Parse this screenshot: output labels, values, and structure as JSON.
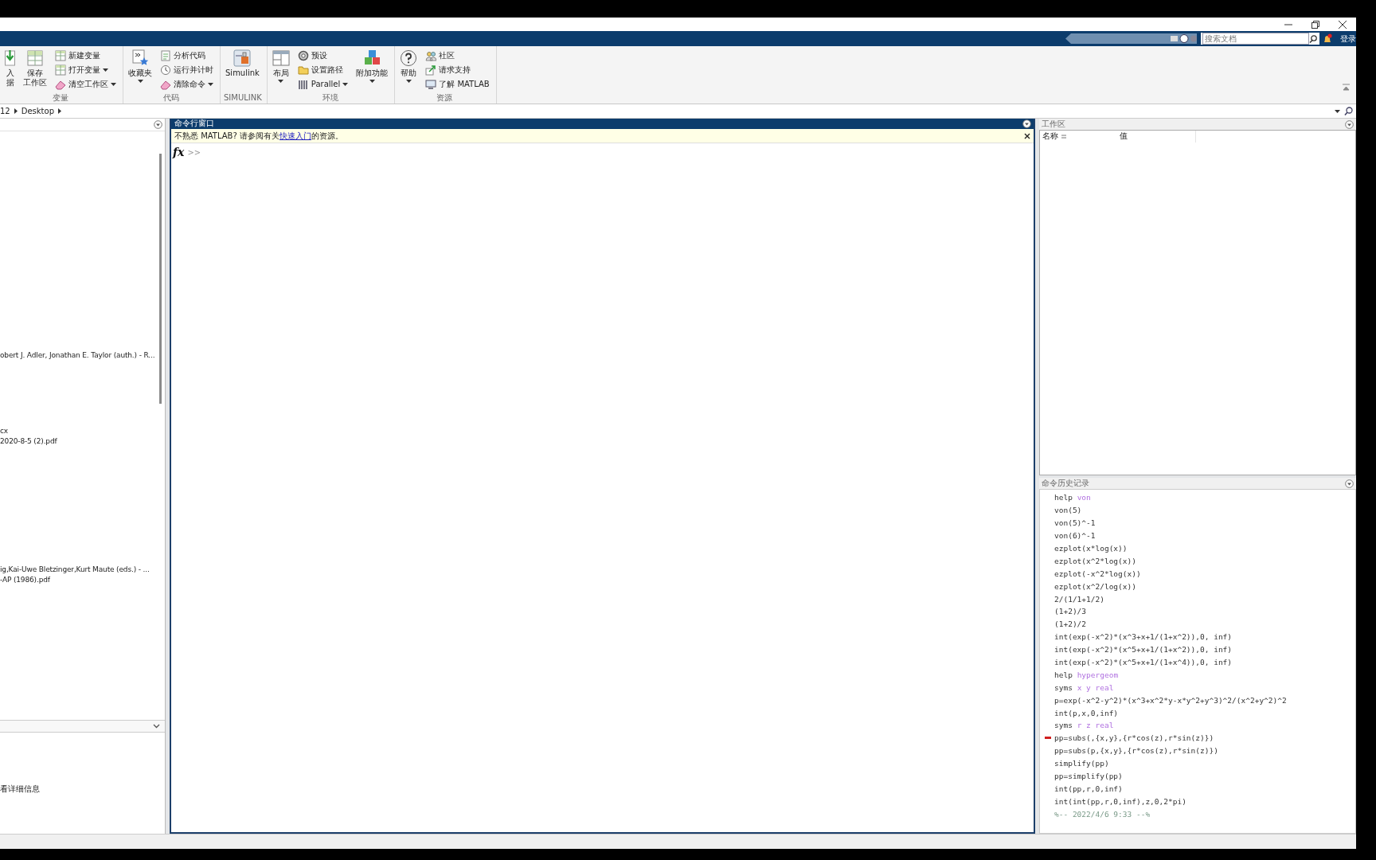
{
  "top_bar": {
    "search": {
      "placeholder": "搜索文档"
    },
    "sign_in": "登录"
  },
  "toolstrip": {
    "groups": [
      {
        "label": "变量",
        "items": [
          {
            "kind": "large",
            "lines": [
              "入",
              "据"
            ],
            "dropdown": false
          },
          {
            "kind": "large",
            "lines": [
              "保存",
              "工作区"
            ],
            "dropdown": false
          },
          {
            "kind": "stack",
            "buttons": [
              {
                "label": "新建变量",
                "dropdown": false
              },
              {
                "label": "打开变量",
                "dropdown": true
              },
              {
                "label": "清空工作区",
                "dropdown": true
              }
            ]
          }
        ]
      },
      {
        "label": "代码",
        "items": [
          {
            "kind": "large",
            "lines": [
              "收藏夹"
            ],
            "dropdown": true
          },
          {
            "kind": "stack",
            "buttons": [
              {
                "label": "分析代码",
                "dropdown": false
              },
              {
                "label": "运行并计时",
                "dropdown": false
              },
              {
                "label": "清除命令",
                "dropdown": true
              }
            ]
          }
        ]
      },
      {
        "label": "SIMULINK",
        "items": [
          {
            "kind": "large",
            "lines": [
              "Simulink"
            ],
            "dropdown": false
          }
        ]
      },
      {
        "label": "环境",
        "items": [
          {
            "kind": "large",
            "lines": [
              "布局"
            ],
            "dropdown": true
          },
          {
            "kind": "stack",
            "buttons": [
              {
                "label": "预设",
                "dropdown": false
              },
              {
                "label": "设置路径",
                "dropdown": false
              },
              {
                "label": "Parallel",
                "dropdown": true
              }
            ]
          },
          {
            "kind": "large",
            "lines": [
              "附加功能"
            ],
            "dropdown": true
          }
        ]
      },
      {
        "label": "资源",
        "items": [
          {
            "kind": "large",
            "lines": [
              "帮助"
            ],
            "dropdown": true
          },
          {
            "kind": "stack",
            "buttons": [
              {
                "label": "社区",
                "dropdown": false
              },
              {
                "label": "请求支持",
                "dropdown": false
              },
              {
                "label": "了解 MATLAB",
                "dropdown": false
              }
            ]
          }
        ]
      }
    ]
  },
  "address_bar": {
    "path": [
      "12",
      "Desktop"
    ]
  },
  "current_folder": {
    "files": [
      {
        "lines": [
          "obert J. Adler, Jonathan E. Taylor (auth.) - R..."
        ]
      },
      {
        "lines": [
          "cx",
          "2020-8-5 (2).pdf"
        ]
      },
      {
        "lines": [
          "ig,Kai-Uwe Bletzinger,Kurt Maute (eds.) -  ...",
          "-AP (1986).pdf"
        ]
      }
    ],
    "details": "看详细信息"
  },
  "command_window": {
    "title": "命令行窗口",
    "notice": {
      "before": "不熟悉 MATLAB? 请参阅有关",
      "link": "快速入门",
      "after": "的资源。"
    },
    "function_button": "fx",
    "prompt": ">>"
  },
  "workspace": {
    "title": "工作区",
    "columns": [
      "名称",
      "值"
    ]
  },
  "command_history": {
    "title": "命令历史记录",
    "entries": [
      {
        "kind": "command",
        "text": "help",
        "args": "von",
        "marked": false
      },
      {
        "kind": "command",
        "text": "von(5)",
        "marked": false
      },
      {
        "kind": "command",
        "text": "von(5)^-1",
        "marked": false
      },
      {
        "kind": "command",
        "text": "von(6)^-1",
        "marked": false
      },
      {
        "kind": "command",
        "text": "ezplot(x*log(x))",
        "marked": false
      },
      {
        "kind": "command",
        "text": "ezplot(x^2*log(x))",
        "marked": false
      },
      {
        "kind": "command",
        "text": "ezplot(-x^2*log(x))",
        "marked": false
      },
      {
        "kind": "command",
        "text": "ezplot(x^2/log(x))",
        "marked": false
      },
      {
        "kind": "command",
        "text": "2/(1/1+1/2)",
        "marked": false
      },
      {
        "kind": "command",
        "text": "(1+2)/3",
        "marked": false
      },
      {
        "kind": "command",
        "text": "(1+2)/2",
        "marked": false
      },
      {
        "kind": "command",
        "text": "int(exp(-x^2)*(x^3+x+1/(1+x^2)),0, inf)",
        "marked": false
      },
      {
        "kind": "command",
        "text": "int(exp(-x^2)*(x^5+x+1/(1+x^2)),0, inf)",
        "marked": false
      },
      {
        "kind": "command",
        "text": "int(exp(-x^2)*(x^5+x+1/(1+x^4)),0, inf)",
        "marked": false
      },
      {
        "kind": "command",
        "text": "help",
        "args": "hypergeom",
        "marked": false
      },
      {
        "kind": "command",
        "text": "syms",
        "args": "x y real",
        "marked": false
      },
      {
        "kind": "command",
        "text": "p=exp(-x^2-y^2)*(x^3+x^2*y-x*y^2+y^3)^2/(x^2+y^2)^2",
        "marked": false
      },
      {
        "kind": "command",
        "text": "int(p,x,0,inf)",
        "marked": false
      },
      {
        "kind": "command",
        "text": "syms",
        "args": "r z real",
        "marked": false
      },
      {
        "kind": "command",
        "text": "pp=subs(,{x,y},{r*cos(z),r*sin(z)})",
        "marked": true
      },
      {
        "kind": "command",
        "text": "pp=subs(p,{x,y},{r*cos(z),r*sin(z)})",
        "marked": false
      },
      {
        "kind": "command",
        "text": "simplify(pp)",
        "marked": false
      },
      {
        "kind": "command",
        "text": "pp=simplify(pp)",
        "marked": false
      },
      {
        "kind": "command",
        "text": "int(pp,r,0,inf)",
        "marked": false
      },
      {
        "kind": "command",
        "text": "int(int(pp,r,0,inf),z,0,2*pi)",
        "marked": false
      },
      {
        "kind": "timestamp",
        "text": "%-- 2022/4/6 9:33 --%",
        "marked": false
      }
    ]
  }
}
